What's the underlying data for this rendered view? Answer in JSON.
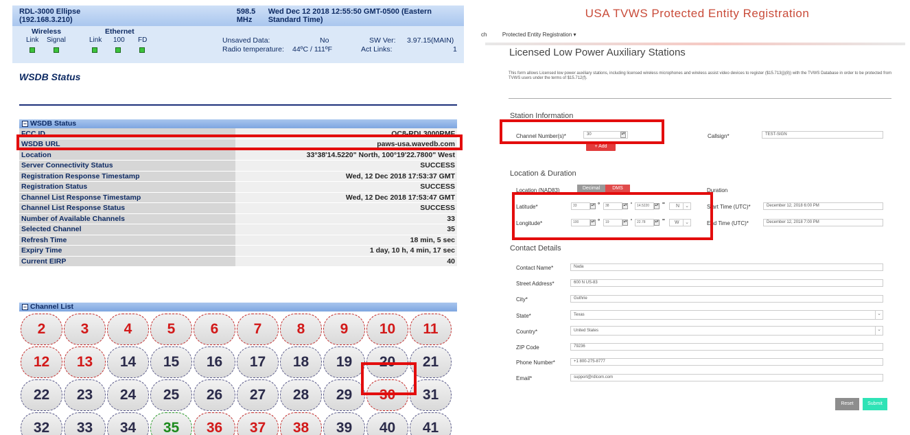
{
  "left": {
    "device_title": "RDL-3000 Ellipse (192.168.3.210)",
    "frequency": "598.5 MHz",
    "datetime": "Wed Dec 12 2018 12:55:50 GMT-0500 (Eastern Standard Time)",
    "wireless_label": "Wireless",
    "ethernet_label": "Ethernet",
    "link_label": "Link",
    "signal_label": "Signal",
    "eth_link_label": "Link",
    "eth_100_label": "100",
    "eth_fd_label": "FD",
    "unsaved_label": "Unsaved Data:",
    "unsaved_value": "No",
    "radio_temp_label": "Radio temperature:",
    "radio_temp_value": "44ºC / 111ºF",
    "sw_ver_label": "SW Ver:",
    "sw_ver_value": "3.97.15(MAIN)",
    "act_links_label": "Act Links:",
    "act_links_value": "1",
    "page_title": "WSDB Status",
    "wsdb_section": "WSDB Status",
    "rows": [
      {
        "k": "FCC ID",
        "v": "QC8-RDL3000RMF"
      },
      {
        "k": "WSDB URL",
        "v": "paws-usa.wavedb.com"
      },
      {
        "k": "Location",
        "v": "33°38'14.5220\" North, 100°19'22.7800\" West"
      },
      {
        "k": "Server Connectivity Status",
        "v": "SUCCESS"
      },
      {
        "k": "Registration Response Timestamp",
        "v": "Wed, 12 Dec 2018 17:53:37 GMT"
      },
      {
        "k": "Registration Status",
        "v": "SUCCESS"
      },
      {
        "k": "Channel List Response Timestamp",
        "v": "Wed, 12 Dec 2018 17:53:47 GMT"
      },
      {
        "k": "Channel List Response Status",
        "v": "SUCCESS"
      },
      {
        "k": "Number of Available Channels",
        "v": "33"
      },
      {
        "k": "Selected Channel",
        "v": "35"
      },
      {
        "k": "Refresh Time",
        "v": "18 min, 5 sec"
      },
      {
        "k": "Expiry Time",
        "v": "1 day, 10 h, 4 min, 17 sec"
      },
      {
        "k": "Current EIRP",
        "v": "40"
      }
    ],
    "channel_section": "Channel List",
    "channels": [
      {
        "n": "2",
        "c": "red"
      },
      {
        "n": "3",
        "c": "red"
      },
      {
        "n": "4",
        "c": "red"
      },
      {
        "n": "5",
        "c": "red"
      },
      {
        "n": "6",
        "c": "red"
      },
      {
        "n": "7",
        "c": "red"
      },
      {
        "n": "8",
        "c": "red"
      },
      {
        "n": "9",
        "c": "red"
      },
      {
        "n": "10",
        "c": "red"
      },
      {
        "n": "11",
        "c": "red"
      },
      {
        "n": "12",
        "c": "red"
      },
      {
        "n": "13",
        "c": "red"
      },
      {
        "n": "14",
        "c": "gray"
      },
      {
        "n": "15",
        "c": "gray"
      },
      {
        "n": "16",
        "c": "gray"
      },
      {
        "n": "17",
        "c": "gray"
      },
      {
        "n": "18",
        "c": "gray"
      },
      {
        "n": "19",
        "c": "gray"
      },
      {
        "n": "20",
        "c": "gray"
      },
      {
        "n": "21",
        "c": "gray"
      },
      {
        "n": "22",
        "c": "gray"
      },
      {
        "n": "23",
        "c": "gray"
      },
      {
        "n": "24",
        "c": "gray"
      },
      {
        "n": "25",
        "c": "gray"
      },
      {
        "n": "26",
        "c": "gray"
      },
      {
        "n": "27",
        "c": "gray"
      },
      {
        "n": "28",
        "c": "gray"
      },
      {
        "n": "29",
        "c": "gray"
      },
      {
        "n": "30",
        "c": "red"
      },
      {
        "n": "31",
        "c": "gray"
      },
      {
        "n": "32",
        "c": "gray"
      },
      {
        "n": "33",
        "c": "gray"
      },
      {
        "n": "34",
        "c": "gray"
      },
      {
        "n": "35",
        "c": "green"
      },
      {
        "n": "36",
        "c": "red"
      },
      {
        "n": "37",
        "c": "red"
      },
      {
        "n": "38",
        "c": "red"
      },
      {
        "n": "39",
        "c": "gray"
      },
      {
        "n": "40",
        "c": "gray"
      },
      {
        "n": "41",
        "c": "gray"
      }
    ]
  },
  "right": {
    "title": "USA TVWS Protected Entity Registration",
    "nav_prefix": "ch",
    "nav_menu": "Protected Entity Registration",
    "form_title": "Licensed Low Power Auxiliary Stations",
    "description": "This form allows Licensed low power auxiliary stations, including licensed wireless microphones and wireless assist video devices to register ($15.713(j)(8)) with the TVWS Database in order to be protected from TVWS users under the terms of $15.712(f).",
    "station_info": "Station Information",
    "channel_label": "Channel Number(s)*",
    "channel_value": "30",
    "add_label": "+ Add",
    "callsign_label": "Callsign*",
    "callsign_value": "TEST-SIGN",
    "location_duration": "Location & Duration",
    "location_label": "Location (NAD83)",
    "decimal_tab": "Decimal",
    "dms_tab": "DMS",
    "duration_label": "Duration",
    "latitude_label": "Latitude*",
    "lat_deg": "33",
    "lat_min": "38",
    "lat_sec": "14.5220",
    "lat_dir": "N",
    "longitude_label": "Longitude*",
    "lon_deg": "100",
    "lon_min": "19",
    "lon_sec": "22.78",
    "lon_dir": "W",
    "deg_symbol": "°",
    "min_symbol": "'",
    "sec_symbol": "''",
    "start_label": "Start Time (UTC)*",
    "start_value": "December 12, 2018 6:00 PM",
    "end_label": "End Time (UTC)*",
    "end_value": "December 12, 2018 7:00 PM",
    "contact_details": "Contact Details",
    "contact_name_label": "Contact Name*",
    "contact_name_value": "Nada",
    "street_label": "Street Address*",
    "street_value": "600 N US-83",
    "city_label": "City*",
    "city_value": "Guthrie",
    "state_label": "State*",
    "state_value": "Texas",
    "country_label": "Country*",
    "country_value": "United States",
    "zip_label": "ZIP Code",
    "zip_value": "79236",
    "phone_label": "Phone Number*",
    "phone_value": "+1 800-275-8777",
    "email_label": "Email*",
    "email_value": "support@rdlcom.com",
    "reset_label": "Reset",
    "submit_label": "Submit"
  },
  "colors": {
    "highlight": "#e30d0d",
    "title_red": "#c94b39",
    "channel_red": "#d21919",
    "channel_green": "#1c8a1c",
    "submit_green": "#2fe3b6",
    "dms_red": "#e04a4a"
  },
  "icons": [
    "collapse-box-icon",
    "dropdown-caret-icon",
    "spinner-icon",
    "select-arrow-icon"
  ]
}
